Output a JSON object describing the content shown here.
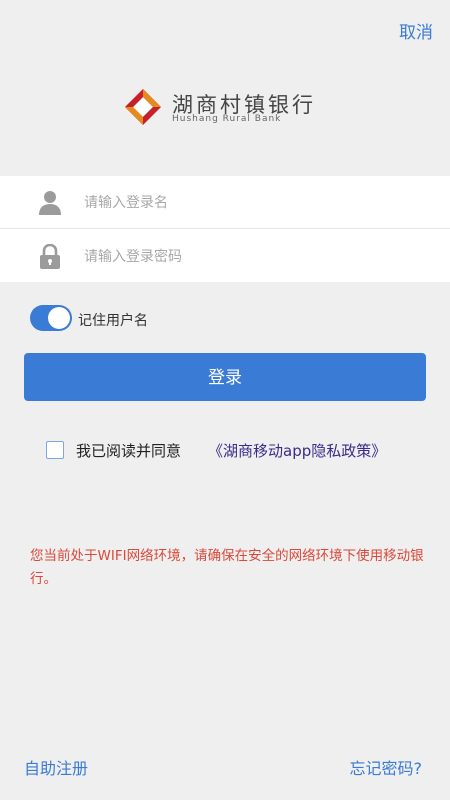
{
  "topbar": {
    "cancel_label": "取消"
  },
  "logo": {
    "name_cn": "湖商村镇银行",
    "name_en": "Hushang Rural Bank"
  },
  "form": {
    "username_placeholder": "请输入登录名",
    "password_placeholder": "请输入登录密码",
    "remember_label": "记住用户名",
    "remember_on": true
  },
  "login_button_label": "登录",
  "agreement": {
    "checked": false,
    "text": "我已阅读并同意",
    "link": "《湖商移动app隐私政策》"
  },
  "warning_text": "您当前处于WIFI网络环境，请确保在安全的网络环境下使用移动银行。",
  "footer": {
    "register_label": "自助注册",
    "forgot_label": "忘记密码?"
  },
  "colors": {
    "accent": "#3a7bd5",
    "warning": "#d94a3a",
    "link": "#3b2a8a",
    "background": "#efefef"
  }
}
